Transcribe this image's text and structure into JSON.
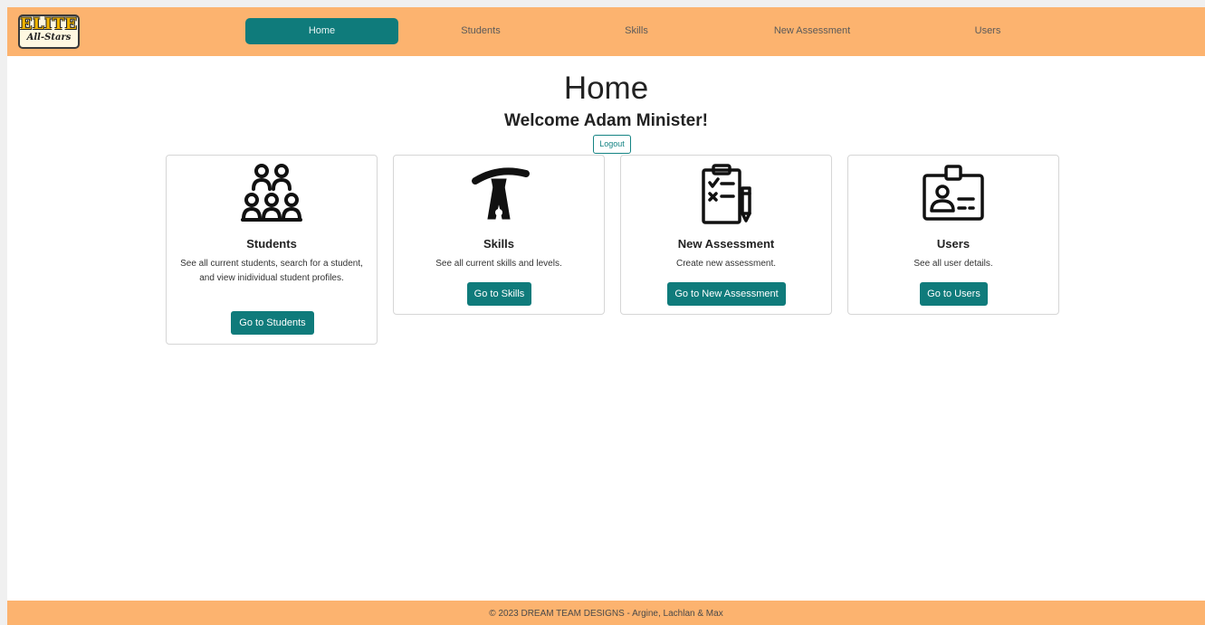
{
  "brand": {
    "logo_top": "ELITE",
    "logo_bottom": "All-Stars"
  },
  "nav": {
    "items": [
      {
        "label": "Home",
        "active": true
      },
      {
        "label": "Students"
      },
      {
        "label": "Skills"
      },
      {
        "label": "New Assessment"
      },
      {
        "label": "Users"
      }
    ]
  },
  "page": {
    "title": "Home",
    "welcome": "Welcome Adam Minister!",
    "logout_label": "Logout"
  },
  "cards": [
    {
      "icon": "students-group-icon",
      "title": "Students",
      "text": "See all current students, search for a student, and view inidividual student profiles.",
      "button": "Go to Students"
    },
    {
      "icon": "gymnast-handstand-icon",
      "title": "Skills",
      "text": "See all current skills and levels.",
      "button": "Go to Skills"
    },
    {
      "icon": "clipboard-checklist-icon",
      "title": "New Assessment",
      "text": "Create new assessment.",
      "button": "Go to New Assessment"
    },
    {
      "icon": "id-badge-icon",
      "title": "Users",
      "text": "See all user details.",
      "button": "Go to Users"
    }
  ],
  "footer": {
    "text": "© 2023 DREAM TEAM DESIGNS - Argine, Lachlan & Max"
  },
  "colors": {
    "navbar": "#fcb36f",
    "accent": "#0f7b7b",
    "footer": "#fcb36f"
  }
}
